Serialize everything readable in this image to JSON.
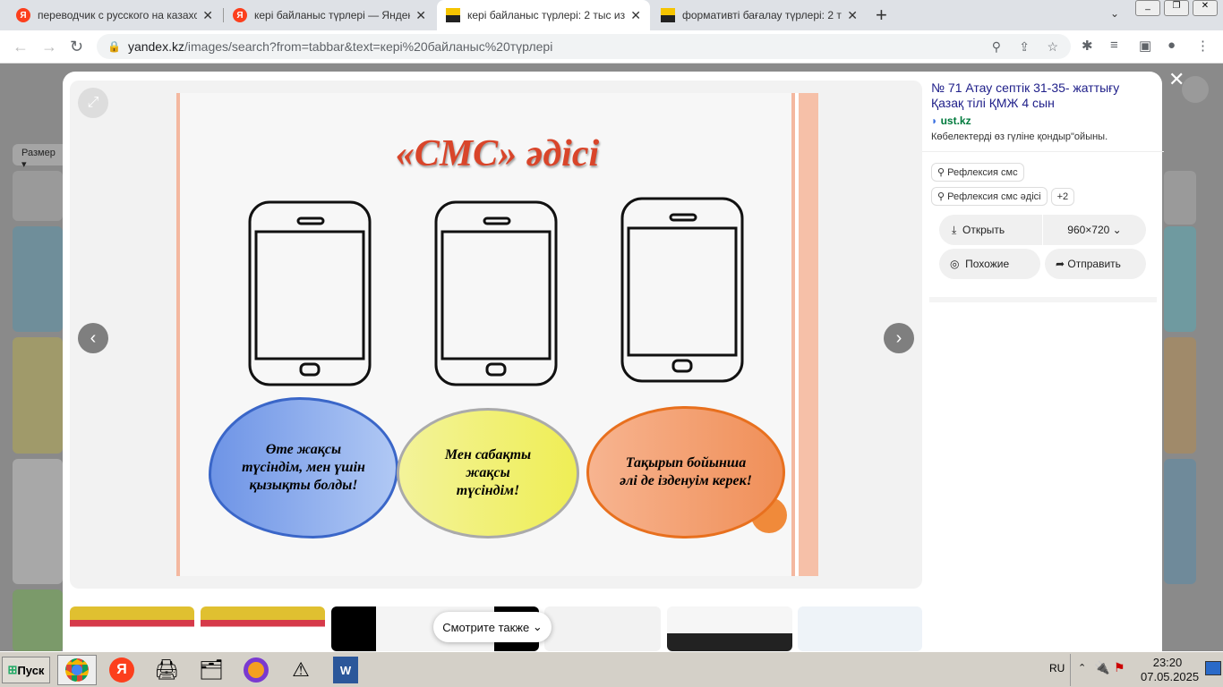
{
  "tabs": [
    {
      "label": "переводчик с русского на казахский",
      "favicon": "yandex-icon"
    },
    {
      "label": "кері байланыс түрлері — Яндекс: н",
      "favicon": "yandex-icon"
    },
    {
      "label": "кері байланыс түрлері: 2 тыс изоб",
      "favicon": "yandex-images-icon",
      "active": true
    },
    {
      "label": "формативті бағалау түрлері: 2 тыс",
      "favicon": "yandex-images-icon"
    }
  ],
  "address": {
    "domain": "yandex.kz",
    "path": "/images/search?from=tabbar&text=кері%20байланыс%20түрлері"
  },
  "page": {
    "size_filter": "Размер"
  },
  "slide": {
    "title": "«СМС» әдісі",
    "clouds": [
      "Өте жақсы түсіндім, мен үшін қызықты болды!",
      "Мен сабақты жақсы түсіндім!",
      "Тақырып бойынша әлі де ізденуім керек!"
    ],
    "colors": [
      "#7fa3e8",
      "#f0ef80",
      "#f0955a"
    ]
  },
  "info": {
    "title": "№ 71 Атау септік 31-35- жаттығу Қазақ тілі ҚМЖ 4 сын",
    "source": "ust.kz",
    "description": "Көбелектерді өз гүліне қондыр\"ойыны.",
    "tags": [
      "Рефлексия смс",
      "Рефлексия смс әдісі"
    ],
    "more_tags": "+2",
    "open": "Открыть",
    "size": "960×720",
    "similar": "Похожие",
    "share": "Отправить"
  },
  "see_also": "Смотрите также",
  "taskbar": {
    "start": "Пуск",
    "lang": "RU",
    "time": "23:20",
    "date": "07.05.2025"
  }
}
